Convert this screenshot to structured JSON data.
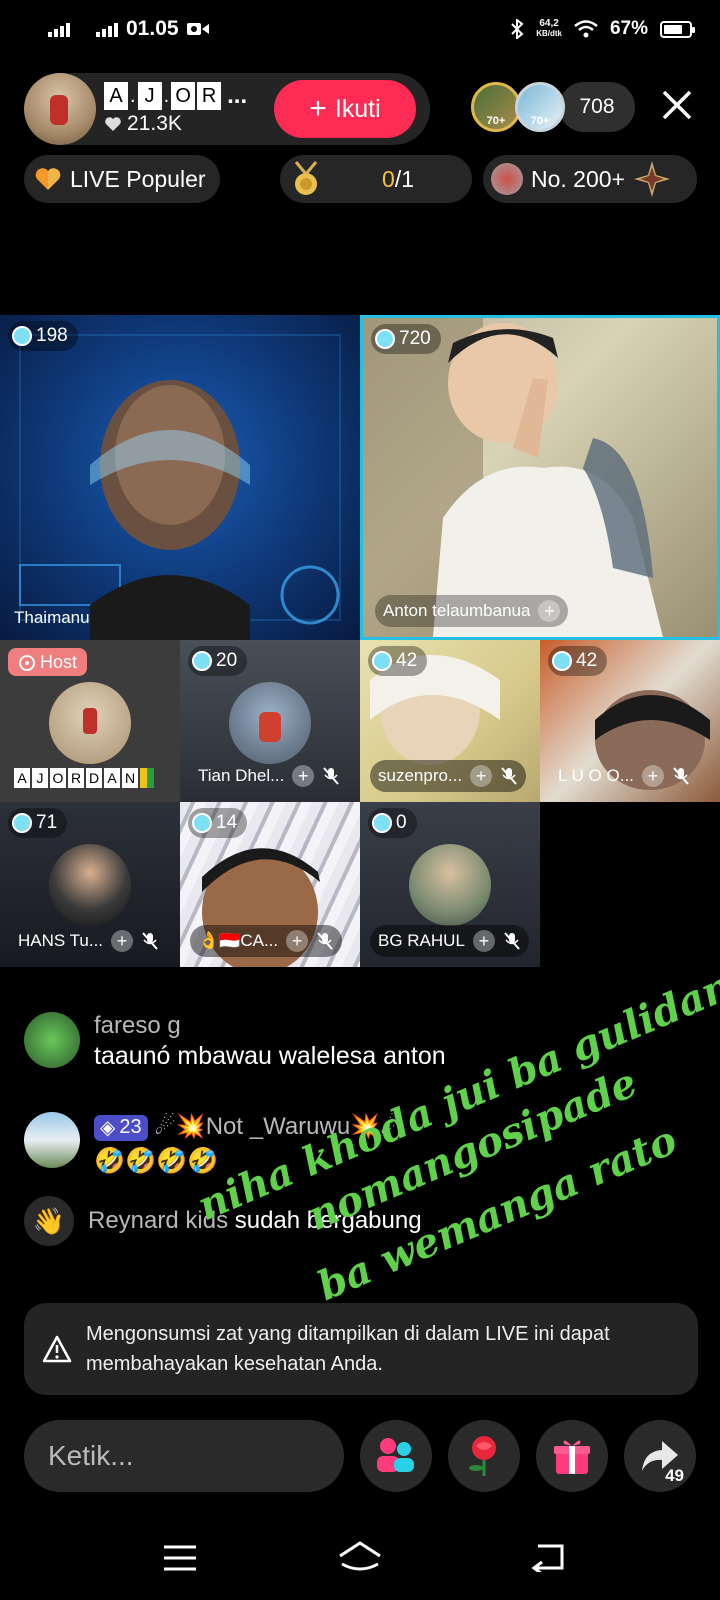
{
  "status_bar": {
    "time": "01.05",
    "net_speed_value": "64,2",
    "net_speed_unit": "KB/dtk",
    "battery": "67%"
  },
  "host": {
    "name_letters": [
      "A",
      "J",
      "O",
      "R"
    ],
    "name_ellipsis": "...",
    "likes": "21.3K",
    "follow_label": "Ikuti"
  },
  "viewers": {
    "badges": [
      "70+",
      "70+"
    ],
    "count": "708"
  },
  "info_row": {
    "live_popular": "LIVE Populer",
    "gift_goal_current": "0",
    "gift_goal_total": "/1",
    "rank": "No. 200+"
  },
  "grid": {
    "tiles": [
      {
        "count": "198",
        "name": "Thaimanu"
      },
      {
        "count": "720",
        "name": "Anton telaumbanua"
      },
      {
        "tag": "Host",
        "name_letters": [
          "A",
          "J",
          "O",
          "R",
          "D",
          "A",
          "N"
        ]
      },
      {
        "count": "20",
        "name": "Tian Dhel..."
      },
      {
        "count": "42",
        "name": "suzenpro..."
      },
      {
        "count": "42",
        "name": "L U O O..."
      },
      {
        "count": "71",
        "name": "HANS Tu..."
      },
      {
        "count": "14",
        "name": "👌🇮🇩CA..."
      },
      {
        "count": "0",
        "name": "BG RAHUL"
      }
    ]
  },
  "chat": {
    "messages": [
      {
        "user": "fareso g",
        "text": "taaunó mbawau walelesa anton"
      },
      {
        "level": "23",
        "user": "☄💥Not _Waruwu💥☄",
        "text": "🤣🤣🤣🤣"
      },
      {
        "user": "Reynard kids",
        "text": "sudah bergabung"
      }
    ]
  },
  "overlay_lines": [
    "niha khoda jui ba gulidano",
    "nomangosipade",
    "ba wemanga rato"
  ],
  "warning": {
    "text": "Mengonsumsi zat yang ditampilkan di dalam LIVE ini dapat membahayakan kesehatan Anda."
  },
  "bottom": {
    "input_placeholder": "Ketik...",
    "share_count": "49"
  },
  "colors": {
    "follow": "#fe2c55",
    "accent_border": "#25c0e0",
    "overlay_text": "#5fd14a",
    "level_badge": "#4b4ec8"
  }
}
